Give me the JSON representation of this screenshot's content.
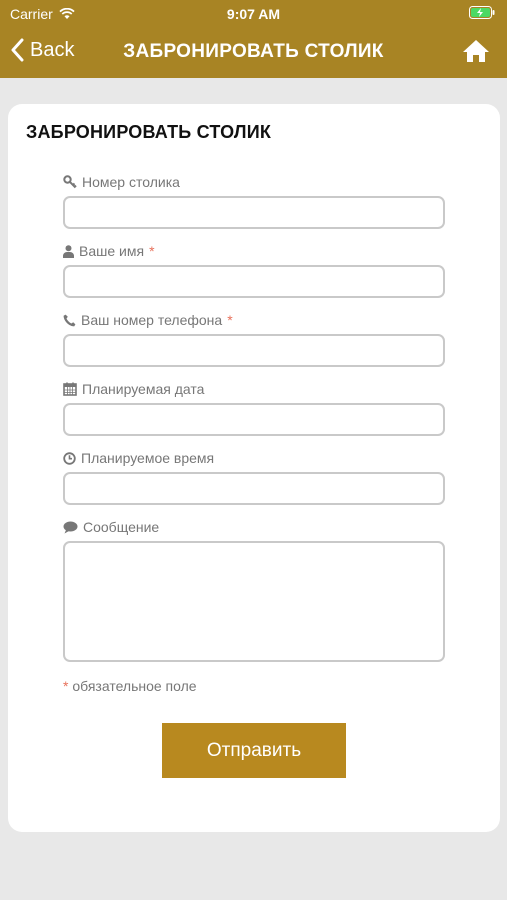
{
  "status_bar": {
    "carrier": "Carrier",
    "time": "9:07 AM"
  },
  "nav": {
    "back_label": "Back",
    "title": "ЗАБРОНИРОВАТЬ СТОЛИК"
  },
  "form": {
    "title": "ЗАБРОНИРОВАТЬ СТОЛИК",
    "fields": [
      {
        "label": "Номер столика",
        "icon": "key-icon",
        "required": false,
        "value": ""
      },
      {
        "label": "Ваше имя",
        "icon": "user-icon",
        "required": true,
        "value": ""
      },
      {
        "label": "Ваш номер телефона",
        "icon": "phone-icon",
        "required": true,
        "value": ""
      },
      {
        "label": "Планируемая дата",
        "icon": "calendar-icon",
        "required": false,
        "value": ""
      },
      {
        "label": "Планируемое время",
        "icon": "clock-icon",
        "required": false,
        "value": ""
      },
      {
        "label": "Сообщение",
        "icon": "comment-icon",
        "required": false,
        "value": ""
      }
    ],
    "required_marker": "*",
    "required_note": "обязательное поле",
    "submit_label": "Отправить"
  },
  "colors": {
    "brand": "#a88424",
    "button": "#b8891f",
    "required": "#e8705a"
  }
}
